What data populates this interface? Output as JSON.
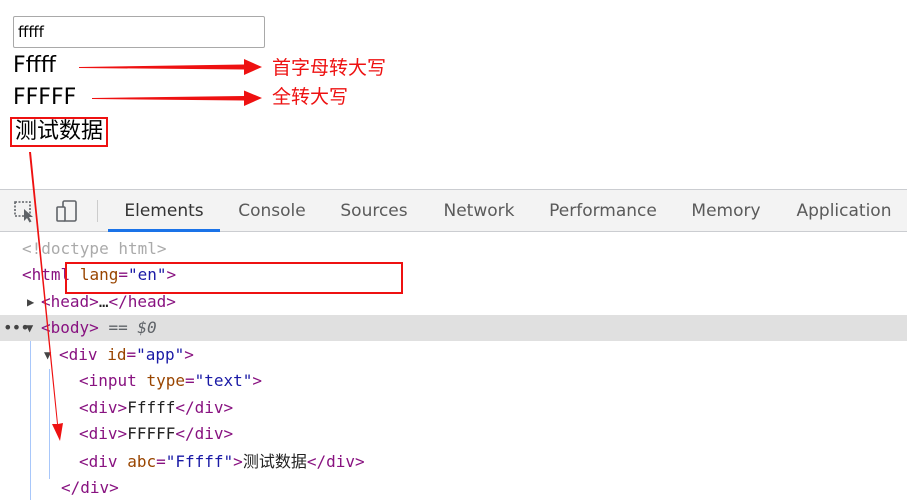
{
  "page": {
    "input": {
      "value": "fffff"
    },
    "output": {
      "capitalized": "Fffff",
      "uppercase": "FFFFF",
      "test_text": "测试数据"
    },
    "annotations": {
      "capitalize_note": "首字母转大写",
      "uppercase_note": "全转大写"
    },
    "accent_color": "#ee1111"
  },
  "devtools": {
    "tabs": [
      {
        "label": "Elements",
        "active": true
      },
      {
        "label": "Console"
      },
      {
        "label": "Sources"
      },
      {
        "label": "Network"
      },
      {
        "label": "Performance"
      },
      {
        "label": "Memory"
      },
      {
        "label": "Application"
      }
    ],
    "icons": {
      "inspect": "inspect-element-icon",
      "device": "device-toolbar-icon"
    },
    "accent_color": "#1a73e8",
    "dom": {
      "doctype": "<!doctype html>",
      "html_tag": "html",
      "html_attr": "lang",
      "html_attr_value": "\"en\"",
      "head_tag": "head",
      "ellipsis": "…",
      "body_tag": "body",
      "body_suffix": "== $0",
      "div_tag": "div",
      "div_id_attr": "id",
      "div_id_value": "\"app\"",
      "input_tag": "input",
      "input_attr": "type",
      "input_attr_value": "\"text\"",
      "div1_text": "Fffff",
      "div2_text": "FFFFF",
      "div3_attr": "abc",
      "div3_attr_value": "\"Fffff\"",
      "div3_text": "测试数据",
      "close_div": "div"
    }
  }
}
